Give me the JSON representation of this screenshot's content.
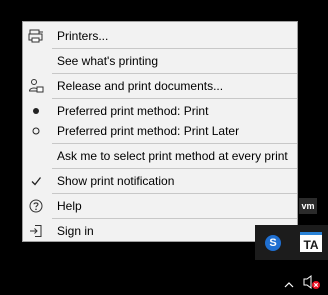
{
  "menu": {
    "items": [
      {
        "label": "Printers...",
        "icon": "printer-icon"
      },
      {
        "label": "See what's printing",
        "icon": ""
      },
      {
        "label": "Release and print documents...",
        "icon": "user-release-icon"
      },
      {
        "label": "Preferred print method: Print",
        "icon": "radio-selected-icon"
      },
      {
        "label": "Preferred print method: Print Later",
        "icon": "radio-unselected-icon"
      },
      {
        "label": "Ask me to select print method at every print",
        "icon": ""
      },
      {
        "label": "Show print notification",
        "icon": "checkmark-icon"
      },
      {
        "label": "Help",
        "icon": "help-icon"
      },
      {
        "label": "Sign in",
        "icon": "sign-in-icon"
      }
    ]
  },
  "tray": {
    "vm_label": "vm",
    "s_label": "S",
    "ta_label": "TA"
  },
  "colors": {
    "menu_bg": "#f2f2f2",
    "desktop": "#000000",
    "accent_blue": "#1f6fd1",
    "mute_red": "#e81123"
  }
}
